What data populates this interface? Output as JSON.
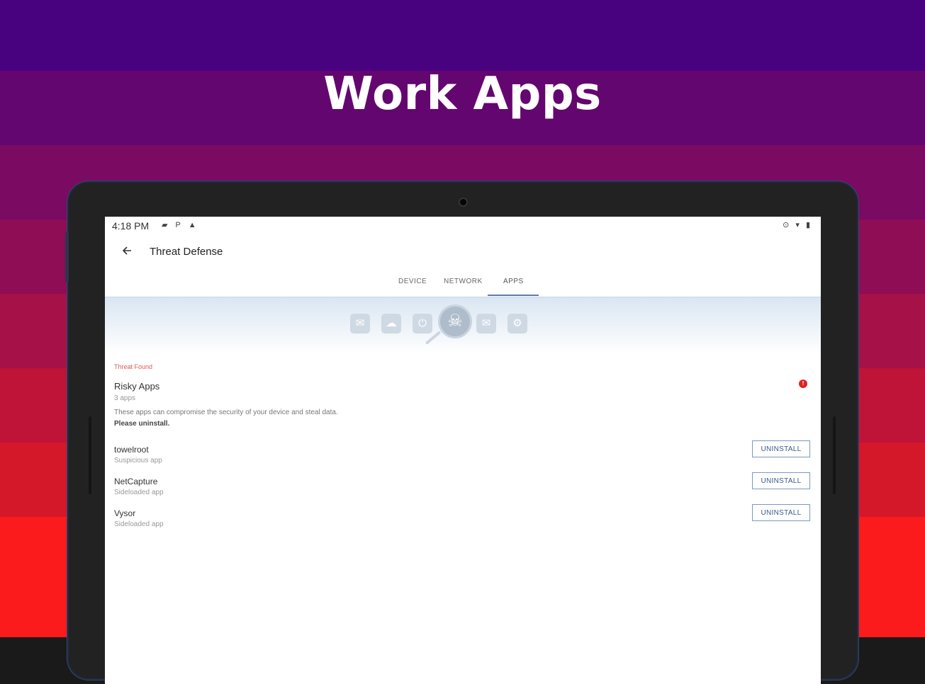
{
  "headline": "Work Apps",
  "colors": {
    "stripes": [
      "#49027f",
      "#640670",
      "#7a0a62",
      "#8f0d55",
      "#a61147",
      "#bf1338",
      "#d5172a",
      "#fb1a1c"
    ],
    "accent": "#5d7ca8",
    "danger": "#dd2222"
  },
  "status_bar": {
    "time": "4:18 PM",
    "left_icons": "▰ P ▲",
    "right_icons": "⊙ ▾ ▮"
  },
  "app_bar": {
    "back_icon": "arrow-left-icon",
    "title": "Threat Defense"
  },
  "tabs": [
    {
      "label": "DEVICE",
      "active": false
    },
    {
      "label": "NETWORK",
      "active": false
    },
    {
      "label": "APPS",
      "active": true
    }
  ],
  "banner_icons": [
    "chat-icon",
    "cloud-icon",
    "power-icon",
    "skull-icon",
    "mail-icon",
    "gear-icon"
  ],
  "threat": {
    "status": "Threat Found",
    "title": "Risky Apps",
    "count": "3 apps",
    "badge": "!",
    "description": "These apps can compromise the security of your device and steal data.",
    "action_text": "Please uninstall."
  },
  "apps": [
    {
      "name": "towelroot",
      "type": "Suspicious app",
      "button": "UNINSTALL"
    },
    {
      "name": "NetCapture",
      "type": "Sideloaded app",
      "button": "UNINSTALL"
    },
    {
      "name": "Vysor",
      "type": "Sideloaded app",
      "button": "UNINSTALL"
    }
  ]
}
